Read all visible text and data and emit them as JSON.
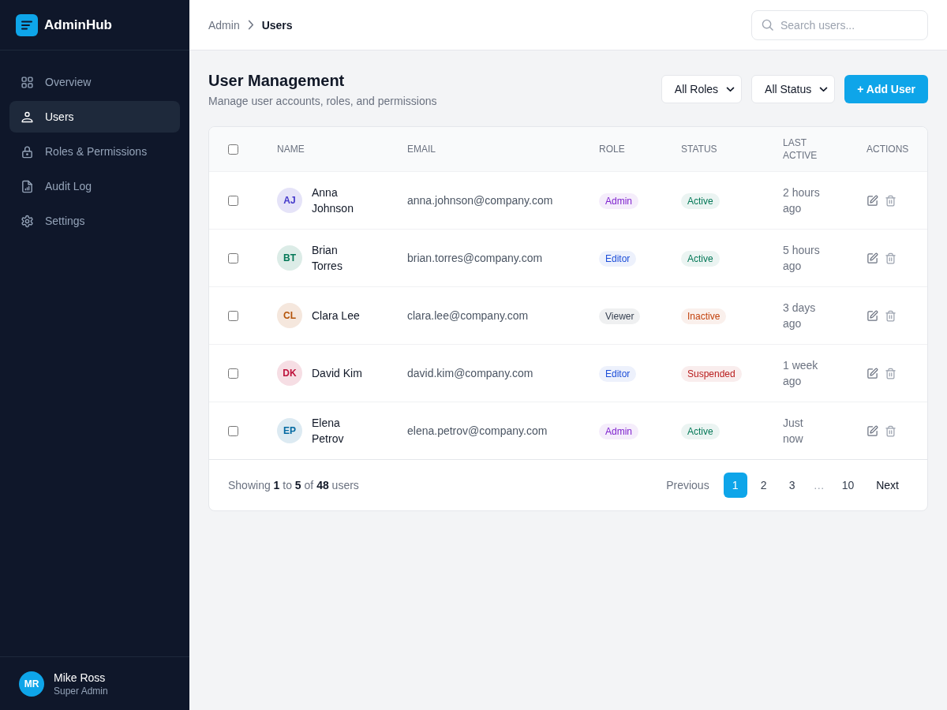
{
  "sidebar": {
    "brand": "AdminHub",
    "items": [
      {
        "label": "Overview",
        "selected": false
      },
      {
        "label": "Users",
        "selected": true
      },
      {
        "label": "Roles & Permissions",
        "selected": false
      },
      {
        "label": "Audit Log",
        "selected": false
      },
      {
        "label": "Settings",
        "selected": false
      }
    ],
    "current_user": {
      "initials": "MR",
      "name": "Mike Ross",
      "role": "Super Admin"
    }
  },
  "topbar": {
    "breadcrumb": [
      {
        "label": "Admin",
        "current": false
      },
      {
        "label": "Users",
        "current": true
      }
    ],
    "search": {
      "placeholder": "Search users..."
    }
  },
  "page": {
    "title": "User Management",
    "subtitle": "Manage user accounts, roles, and permissions",
    "filters": [
      {
        "value": "All Roles"
      },
      {
        "value": "All Status"
      }
    ],
    "add_button": "+ Add User"
  },
  "table": {
    "select_all": {
      "checked": false
    },
    "columns": [
      "NAME",
      "EMAIL",
      "ROLE",
      "STATUS",
      "LAST ACTIVE",
      "ACTIONS"
    ],
    "rows": [
      {
        "checked": false,
        "avatar": {
          "initials": "AJ",
          "color": "#4338ca"
        },
        "name": "Anna Johnson",
        "email": "anna.johnson@company.com",
        "role": {
          "label": "Admin",
          "color": "#7e22ce"
        },
        "status": {
          "label": "Active",
          "color": "#047857"
        },
        "last_active": "2 hours ago"
      },
      {
        "checked": false,
        "avatar": {
          "initials": "BT",
          "color": "#047857"
        },
        "name": "Brian Torres",
        "email": "brian.torres@company.com",
        "role": {
          "label": "Editor",
          "color": "#1d4ed8"
        },
        "status": {
          "label": "Active",
          "color": "#047857"
        },
        "last_active": "5 hours ago"
      },
      {
        "checked": false,
        "avatar": {
          "initials": "CL",
          "color": "#b45309"
        },
        "name": "Clara Lee",
        "email": "clara.lee@company.com",
        "role": {
          "label": "Viewer",
          "color": "#374151"
        },
        "status": {
          "label": "Inactive",
          "color": "#c2410c"
        },
        "last_active": "3 days ago"
      },
      {
        "checked": false,
        "avatar": {
          "initials": "DK",
          "color": "#be123c"
        },
        "name": "David Kim",
        "email": "david.kim@company.com",
        "role": {
          "label": "Editor",
          "color": "#1d4ed8"
        },
        "status": {
          "label": "Suspended",
          "color": "#b91c1c"
        },
        "last_active": "1 week ago"
      },
      {
        "checked": false,
        "avatar": {
          "initials": "EP",
          "color": "#0369a1"
        },
        "name": "Elena Petrov",
        "email": "elena.petrov@company.com",
        "role": {
          "label": "Admin",
          "color": "#7e22ce"
        },
        "status": {
          "label": "Active",
          "color": "#047857"
        },
        "last_active": "Just now"
      }
    ]
  },
  "footer": {
    "summary": "Showing **1** to **5** of **48** users",
    "previous": {
      "label": "Previous",
      "disabled": true
    },
    "pages": [
      {
        "kind": "page",
        "label": "1",
        "selected": true
      },
      {
        "kind": "page",
        "label": "2",
        "selected": false
      },
      {
        "kind": "page",
        "label": "3",
        "selected": false
      },
      {
        "kind": "ellipsis",
        "label": "…"
      },
      {
        "kind": "page",
        "label": "10",
        "selected": false
      }
    ],
    "next": {
      "label": "Next",
      "disabled": false
    }
  }
}
